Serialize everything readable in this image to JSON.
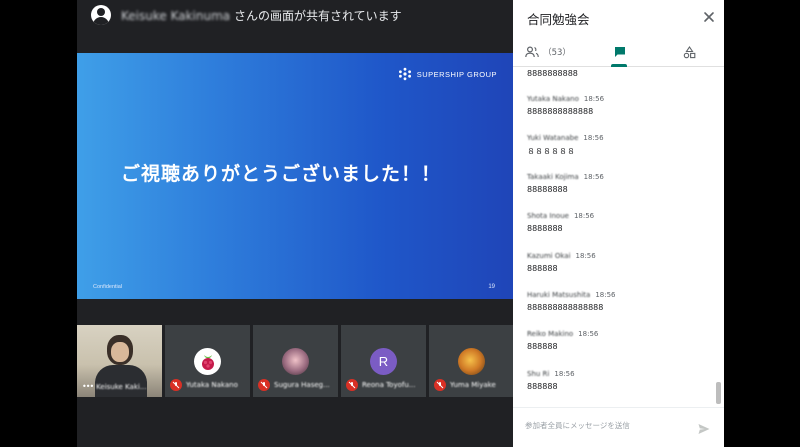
{
  "share_banner": {
    "presenter_name": "Keisuke Kakinuma",
    "suffix": "さんの画面が共有されています"
  },
  "slide": {
    "brand": "SUPERSHIP GROUP",
    "title": "ご視聴ありがとうございました！！",
    "footer": "Confidential",
    "page": "19"
  },
  "participants": [
    {
      "name": "Keisuke Kaki...",
      "type": "video",
      "muted": false
    },
    {
      "name": "Yutaka Nakano",
      "type": "raspberry-pi-avatar",
      "muted": true
    },
    {
      "name": "Sugura Haseg...",
      "type": "anime-avatar",
      "muted": true
    },
    {
      "name": "Reona Toyofu...",
      "type": "letter-avatar",
      "initial": "R",
      "muted": true
    },
    {
      "name": "Yuma Miyake",
      "type": "flower-avatar",
      "muted": true
    }
  ],
  "panel": {
    "title": "合同勉強会",
    "participant_count": "（53）",
    "tabs": [
      "people-icon",
      "chat-icon",
      "activities-icon"
    ],
    "accent": "#00796b"
  },
  "chat": {
    "first_message": "8888888888",
    "messages": [
      {
        "sender": "Yutaka Nakano",
        "time": "18:56",
        "text": "8888888888888"
      },
      {
        "sender": "Yuki Watanabe",
        "time": "18:56",
        "text": "８８８８８８"
      },
      {
        "sender": "Takaaki Kojima",
        "time": "18:56",
        "text": "88888888"
      },
      {
        "sender": "Shota Inoue",
        "time": "18:56",
        "text": "8888888"
      },
      {
        "sender": "Kazumi Okai",
        "time": "18:56",
        "text": "888888"
      },
      {
        "sender": "Haruki Matsushita",
        "time": "18:56",
        "text": "888888888888888"
      },
      {
        "sender": "Reiko Makino",
        "time": "18:56",
        "text": "888888"
      },
      {
        "sender": "Shu Ri",
        "time": "18:56",
        "text": "888888"
      }
    ]
  },
  "composer": {
    "placeholder": "参加者全員にメッセージを送信"
  }
}
